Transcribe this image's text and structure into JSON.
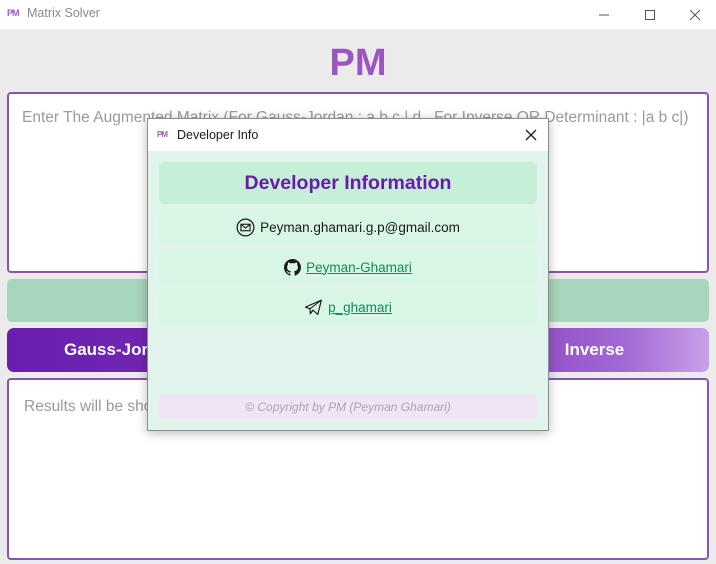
{
  "window": {
    "logo_text": "PM",
    "title": "Matrix Solver"
  },
  "brand": "PM",
  "matrix_input": {
    "placeholder": "Enter The Augmented Matrix (For Gauss-Jordan : a b c | d , For Inverse OR Determinant : |a b c|)"
  },
  "buttons": {
    "gauss_jordan": "Gauss-Jordan",
    "inverse": "Inverse"
  },
  "results": {
    "placeholder": "Results will be shown here..."
  },
  "dialog": {
    "logo_text": "PM",
    "title": "Developer Info",
    "header": "Developer Information",
    "email": "Peyman.ghamari.g.p@gmail.com",
    "github": "Peyman-Ghamari",
    "telegram": "p_ghamari",
    "copyright": "© Copyright by PM (Peyman Ghamari)"
  },
  "colors": {
    "brand_purple": "#9b55c0",
    "header_purple": "#6a1aa6",
    "link_green": "#16865a",
    "dialog_bg": "#e0f4ec",
    "row_bg": "#d8f6e4"
  },
  "icons": {
    "email": "envelope-circle-icon",
    "github": "github-icon",
    "telegram": "paper-plane-icon"
  }
}
